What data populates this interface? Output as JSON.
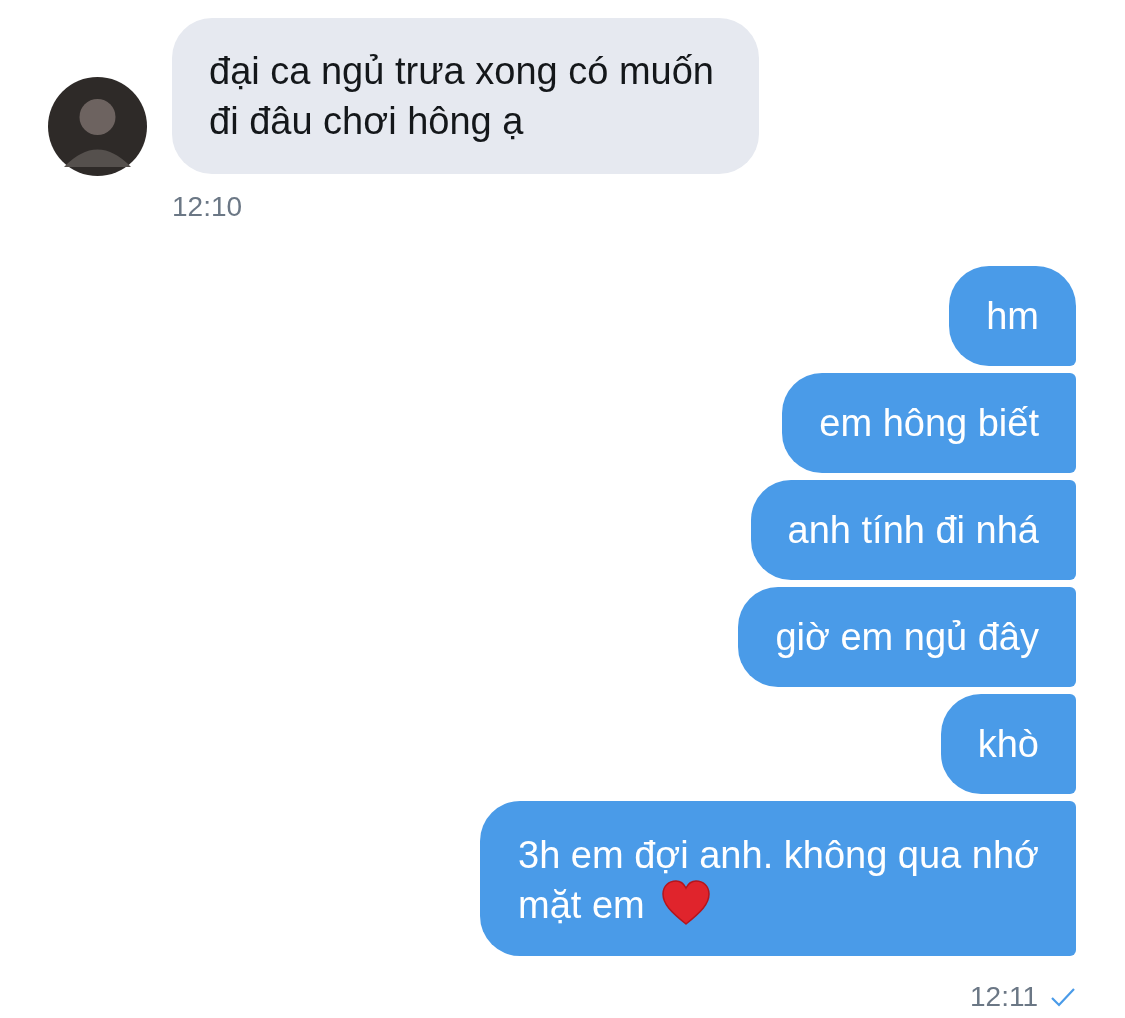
{
  "received": {
    "text": "đại ca ngủ trưa xong có muốn\nđi đâu chơi hông ạ",
    "time": "12:10"
  },
  "sent": [
    {
      "text": "hm",
      "heart": false
    },
    {
      "text": "em hông biết",
      "heart": false
    },
    {
      "text": "anh tính đi nhá",
      "heart": false
    },
    {
      "text": "giờ em ngủ đây",
      "heart": false
    },
    {
      "text": "khò",
      "heart": false
    },
    {
      "text": "3h em đợi anh. không qua nhớ\nmặt em",
      "heart": true
    }
  ],
  "sent_time": "12:11",
  "read": true
}
